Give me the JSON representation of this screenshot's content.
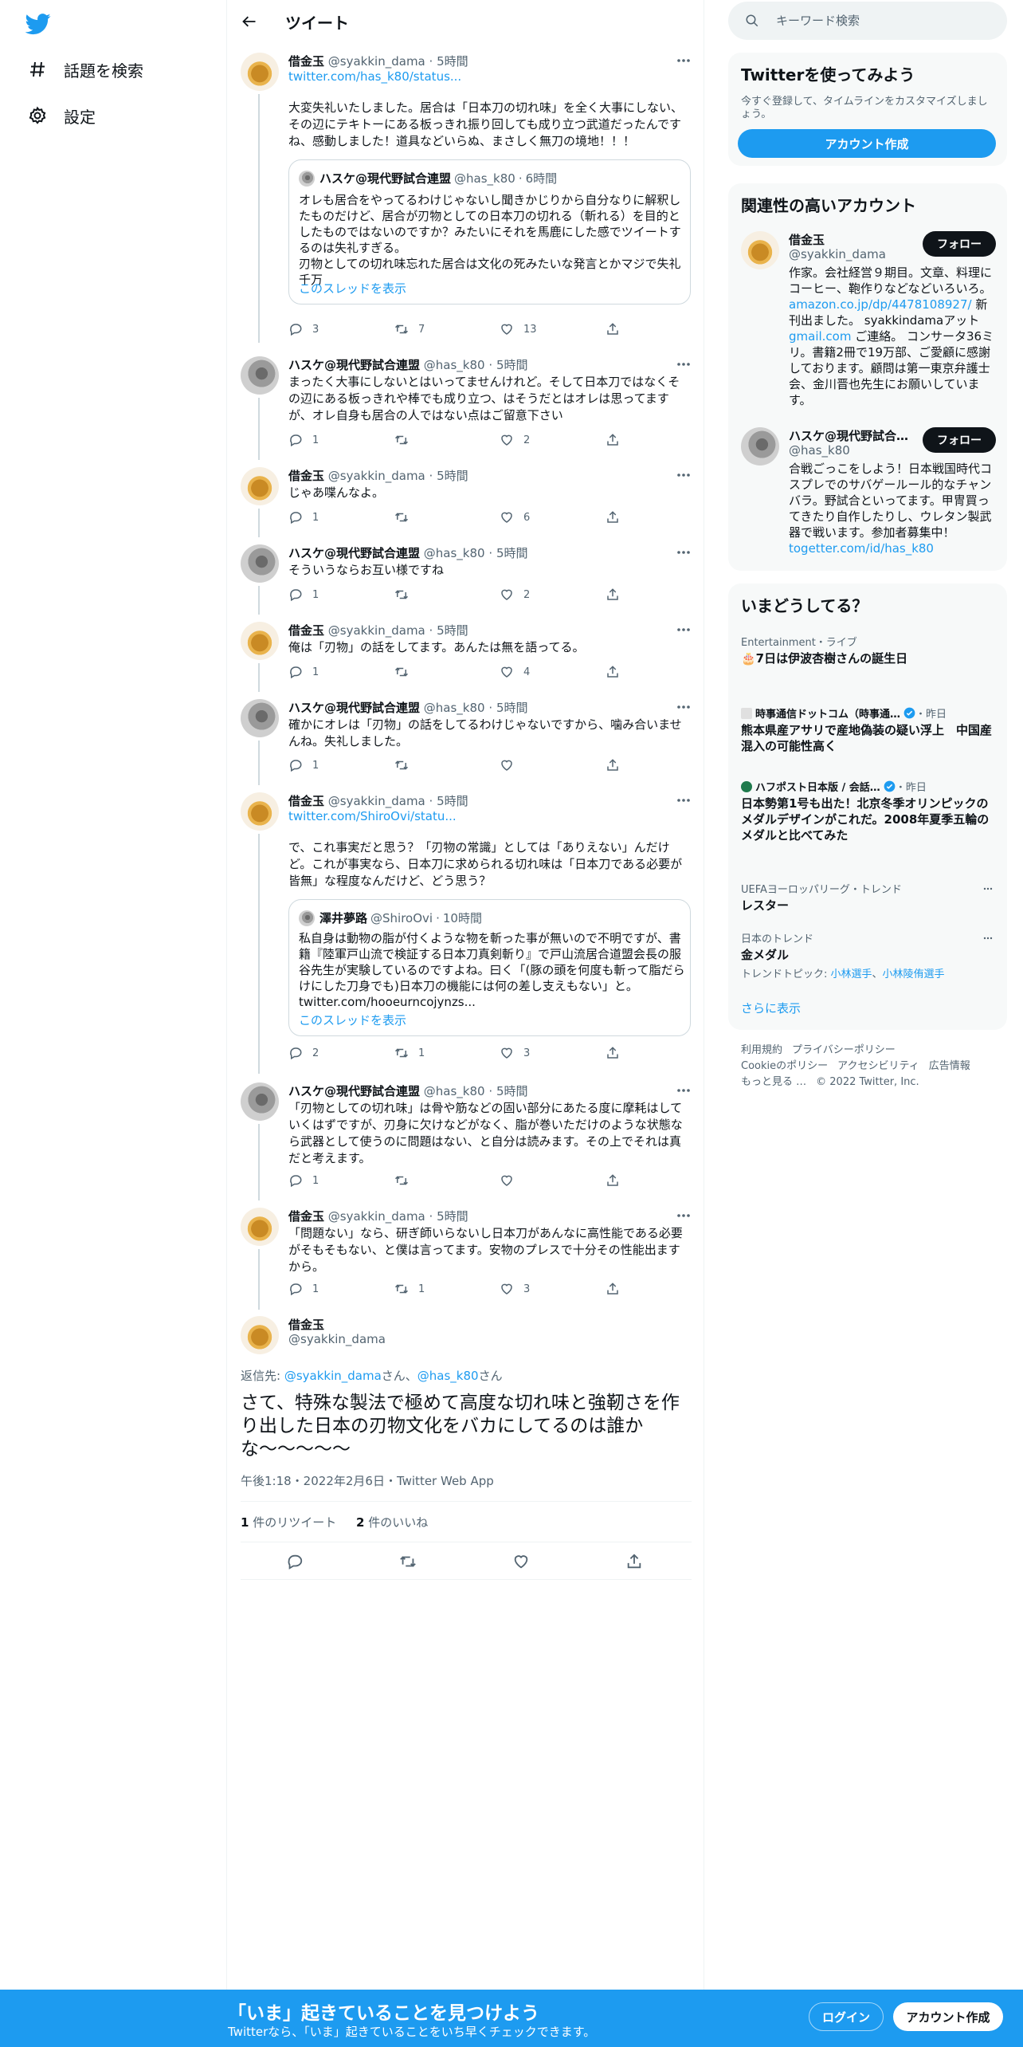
{
  "nav": {
    "explore_label": "話題を検索",
    "settings_label": "設定"
  },
  "header": {
    "title": "ツイート"
  },
  "tweets": [
    {
      "name": "借金玉",
      "handle": "@syakkin_dama",
      "time": "5時間",
      "link": "twitter.com/has_k80/status...",
      "text": "大変失礼いたしました。居合は「日本刀の切れ味」を全く大事にしない、その辺にテキトーにある板っきれ振り回しても成り立つ武道だったんですね、感動しました！道具などいらぬ、まさしく無刀の境地！！！",
      "quote": {
        "name": "ハスケ@現代野試合連盟",
        "handle": "@has_k80",
        "time": "6時間",
        "text": "オレも居合をやってるわけじゃないし聞きかじりから自分なりに解釈したものだけど、居合が刃物としての日本刀の切れる（斬れる）を目的としたものではないのですか？みたいにそれを馬鹿にした感でツイートするのは失礼すぎる。\n刃物としての切れ味忘れた居合は文化の死みたいな発言とかマジで失礼千万",
        "more": "このスレッドを表示"
      },
      "replies": "3",
      "retweets": "7",
      "likes": "13"
    },
    {
      "name": "ハスケ@現代野試合連盟",
      "handle": "@has_k80",
      "time": "5時間",
      "text": "まったく大事にしないとはいってませんけれど。そして日本刀ではなくその辺にある板っきれや棒でも成り立つ、はそうだとはオレは思ってますが、オレ自身も居合の人ではない点はご留意下さい",
      "replies": "1",
      "retweets": "",
      "likes": "2"
    },
    {
      "name": "借金玉",
      "handle": "@syakkin_dama",
      "time": "5時間",
      "text": "じゃあ喋んなよ。",
      "replies": "1",
      "retweets": "",
      "likes": "6"
    },
    {
      "name": "ハスケ@現代野試合連盟",
      "handle": "@has_k80",
      "time": "5時間",
      "text": "そういうならお互い様ですね",
      "replies": "1",
      "retweets": "",
      "likes": "2"
    },
    {
      "name": "借金玉",
      "handle": "@syakkin_dama",
      "time": "5時間",
      "text": "俺は「刃物」の話をしてます。あんたは無を語ってる。",
      "replies": "1",
      "retweets": "",
      "likes": "4"
    },
    {
      "name": "ハスケ@現代野試合連盟",
      "handle": "@has_k80",
      "time": "5時間",
      "text": "確かにオレは「刃物」の話をしてるわけじゃないですから、噛み合いませんね。失礼しました。",
      "replies": "1",
      "retweets": "",
      "likes": ""
    },
    {
      "name": "借金玉",
      "handle": "@syakkin_dama",
      "time": "5時間",
      "link": "twitter.com/ShiroOvi/statu...",
      "text": "で、これ事実だと思う？「刃物の常識」としては「ありえない」んだけど。これが事実なら、日本刀に求められる切れ味は「日本刀である必要が皆無」な程度なんだけど、どう思う？",
      "quote": {
        "name": "澤井夢路",
        "handle": "@ShiroOvi",
        "time": "10時間",
        "text": "私自身は動物の脂が付くような物を斬った事が無いので不明ですが、書籍『陸軍戸山流で検証する日本刀真剣斬り』で戸山流居合道盟会長の服谷先生が実験しているのですよね。曰く「(豚の頭を何度も斬って脂だらけにした刀身でも)日本刀の機能には何の差し支えもない」と。\ntwitter.com/hooeurncojynzs...",
        "more": "このスレッドを表示"
      },
      "replies": "2",
      "retweets": "1",
      "likes": "3"
    },
    {
      "name": "ハスケ@現代野試合連盟",
      "handle": "@has_k80",
      "time": "5時間",
      "text": "「刃物としての切れ味」は骨や筋などの固い部分にあたる度に摩耗はしていくはずですが、刃身に欠けなどがなく、脂が巻いただけのような状態なら武器として使うのに問題はない、と自分は読みます。その上でそれは真だと考えます。",
      "replies": "1",
      "retweets": "",
      "likes": ""
    },
    {
      "name": "借金玉",
      "handle": "@syakkin_dama",
      "time": "5時間",
      "text": "「問題ない」なら、研ぎ師いらないし日本刀があんなに高性能である必要がそもそもない、と僕は言ってます。安物のプレスで十分その性能出ますから。",
      "replies": "1",
      "retweets": "1",
      "likes": "3"
    }
  ],
  "focused": {
    "name": "借金玉",
    "handle": "@syakkin_dama",
    "reply_prefix": "返信先: ",
    "reply_user1": "@syakkin_dama",
    "reply_mid": "さん、",
    "reply_user2": "@has_k80",
    "reply_suffix": "さん",
    "text": "さて、特殊な製法で極めて高度な切れ味と強靭さを作り出した日本の刃物文化をバカにしてるのは誰かな〜〜〜〜〜",
    "meta": "午後1:18・2022年2月6日・Twitter Web App",
    "retweet_count": "1",
    "retweet_label": " 件のリツイート",
    "like_count": "2",
    "like_label": " 件のいいね"
  },
  "sidebar": {
    "search_placeholder": "キーワード検索",
    "signup": {
      "title": "Twitterを使ってみよう",
      "subtitle": "今すぐ登録して、タイムラインをカスタマイズしましょう。",
      "button": "アカウント作成"
    },
    "relevant": {
      "title": "関連性の高いアカウント",
      "accounts": [
        {
          "name": "借金玉",
          "handle": "@syakkin_dama",
          "follow": "フォロー",
          "bio_1": "作家。会社経営９期目。文章、料理にコーヒー、鞄作りなどなどいろいろ。",
          "bio_link": "amazon.co.jp/dp/4478108927/",
          "bio_2": " 新刊出ました。 syakkindamaアット",
          "bio_link2": "gmail.com",
          "bio_3": " ご連絡。 コンサータ36ミリ。書籍2冊で19万部、ご愛顧に感謝しております。顧問は第一東京弁護士会、金川晋也先生にお願いしています。"
        },
        {
          "name": "ハスケ@現代野試合連盟",
          "handle": "@has_k80",
          "follow": "フォロー",
          "bio_1": "合戦ごっこをしよう！日本戦国時代コスプレでのサバゲールール的なチャンバラ。野試合といってます。甲冑買ってきたり自作したりし、ウレタン製武器で戦います。参加者募集中！",
          "bio_link": "togetter.com/id/has_k80"
        }
      ]
    },
    "trends": {
      "title": "いまどうしてる？",
      "items": [
        {
          "context": "Entertainment・ライブ",
          "title": "🎂7日は伊波杏樹さんの誕生日"
        },
        {
          "source": "時事通信ドットコム（時事通…",
          "time": "・昨日",
          "title": "熊本県産アサリで産地偽装の疑い浮上　中国産混入の可能性高く"
        },
        {
          "source": "ハフポスト日本版 / 会話…",
          "time": "・昨日",
          "title": "日本勢第1号も出た！北京冬季オリンピックのメダルデザインがこれだ。2008年夏季五輪のメダルと比べてみた"
        },
        {
          "context": "UEFAヨーロッパリーグ・トレンド",
          "title": "レスター"
        },
        {
          "context": "日本のトレンド",
          "title": "金メダル",
          "topic_label": "トレンドトピック: ",
          "topic_1": "小林選手",
          "topic_sep": "、",
          "topic_2": "小林陵侑選手"
        }
      ],
      "show_more": "さらに表示"
    },
    "footer": {
      "links": [
        "利用規約",
        "プライバシーポリシー",
        "Cookieのポリシー",
        "アクセシビリティ",
        "広告情報",
        "もっと見る …"
      ],
      "copyright": "© 2022 Twitter, Inc."
    }
  },
  "banner": {
    "title": "「いま」起きていることを見つけよう",
    "subtitle": "Twitterなら、「いま」起きていることをいち早くチェックできます。",
    "login": "ログイン",
    "signup": "アカウント作成"
  },
  "colors": {
    "accent": "#1d9bf0",
    "text": "#0f1419",
    "muted": "#536471",
    "panel": "#f7f9f9"
  }
}
